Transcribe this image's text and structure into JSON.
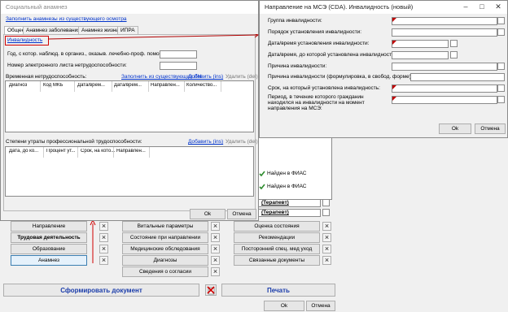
{
  "main_window": {
    "title": "Социальный анамнез",
    "fill_link": "Заполнить анамнезы из существующего осмотра",
    "tabs": [
      {
        "label": "Общее",
        "active": true
      },
      {
        "label": "Анамнез заболевания",
        "active": false
      },
      {
        "label": "Анамнез жизни",
        "active": false
      },
      {
        "label": "ИПРА",
        "active": false
      }
    ],
    "disability_link": "Инвалидность",
    "year_label": "Год, с котор. наблюд. в организ., оказыв. лечебно-проф. помощь:",
    "sick_leave_label": "Номер электронного листа нетрудоспособности:",
    "temp_disability": {
      "label": "Временная нетрудоспособность:",
      "fill_link": "Заполнить из существующих ЛН",
      "add_link": "Добавить (ins)",
      "delete_link": "Удалить (del)",
      "columns": [
        "Диагноз",
        "Код МКБ",
        "Дата/врем...",
        "Дата/врем...",
        "Направлен...",
        "Количество..."
      ]
    },
    "prof_disability": {
      "label": "Степени утраты профессиональной трудоспособности:",
      "add_link": "Добавить (ins)",
      "delete_link": "Удалить (del)",
      "columns": [
        "Дата, до ко...",
        "Процент ут...",
        "Срок, на кото...",
        "Направлен..."
      ]
    },
    "ok_label": "Ok",
    "cancel_label": "Отмена"
  },
  "disability_dialog": {
    "title": "Направление на МСЭ (CDA). Инвалидность (новый)",
    "fields": [
      "Группа инвалидности:",
      "Порядок установления инвалидности:",
      "Дата/время установления инвалидности:",
      "Дата/время, до которой установлена инвалидность:",
      "Причина инвалидности:",
      "Причина инвалидности (формулировка, в свобод. форме):",
      "Срок, на который установлена инвалидность:",
      "Период, в течение которого гражданин находился на инвалидности на момент направления на МСЭ:"
    ],
    "ok_label": "Ok",
    "cancel_label": "Отмена"
  },
  "background": {
    "fias": [
      "Найден в ФИАС",
      "Найден в ФИАС"
    ],
    "therapist": [
      "(Терапевт)",
      "(Терапевт)"
    ],
    "col1": [
      "Направление",
      "Трудовая деятельность",
      "Образование",
      "Анамнез"
    ],
    "col2": [
      "Витальные параметры",
      "Состояние при направлении",
      "Медицинские обследования",
      "Диагнозы",
      "Сведения о согласии"
    ],
    "col3": [
      "Оценка состояния",
      "Рекомендации",
      "Посторонний спец. мед уход",
      "Связанные документы"
    ],
    "form_doc": "Сформировать документ",
    "print": "Печать",
    "ok_label": "Ok",
    "cancel_label": "Отмена"
  }
}
